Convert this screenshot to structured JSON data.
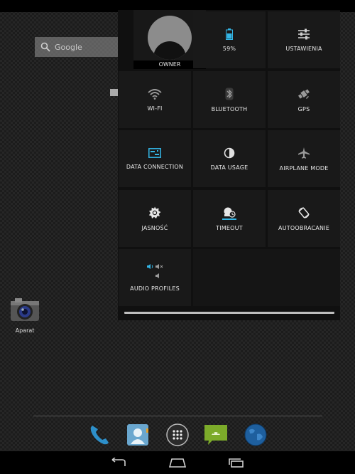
{
  "home": {
    "search_label": "Google",
    "app_label": "Aparat"
  },
  "quick_settings": {
    "owner": "OWNER",
    "battery": "59%",
    "settings": "USTAWIENIA",
    "wifi": "WI-FI",
    "bluetooth": "BLUETOOTH",
    "gps": "GPS",
    "data_connection": "DATA CONNECTION",
    "data_usage": "DATA USAGE",
    "airplane": "AIRPLANE MODE",
    "brightness": "JASNOŚĆ",
    "timeout": "TIMEOUT",
    "autorotate": "AUTOOBRACANIE",
    "audio_profiles": "AUDIO PROFILES"
  },
  "colors": {
    "accent": "#33b5e5",
    "icon": "#cfcfcf",
    "panel_bg": "#101010",
    "tile_bg": "#191919"
  },
  "icons": {
    "battery": "battery-icon",
    "settings": "sliders-icon",
    "wifi": "wifi-icon",
    "bluetooth": "bluetooth-icon",
    "gps": "gps-icon",
    "data_connection": "data-connection-icon",
    "data_usage": "data-usage-icon",
    "airplane": "airplane-icon",
    "brightness": "brightness-icon",
    "timeout": "timeout-icon",
    "autorotate": "rotate-icon",
    "audio_profiles": "audio-profiles-icon"
  }
}
